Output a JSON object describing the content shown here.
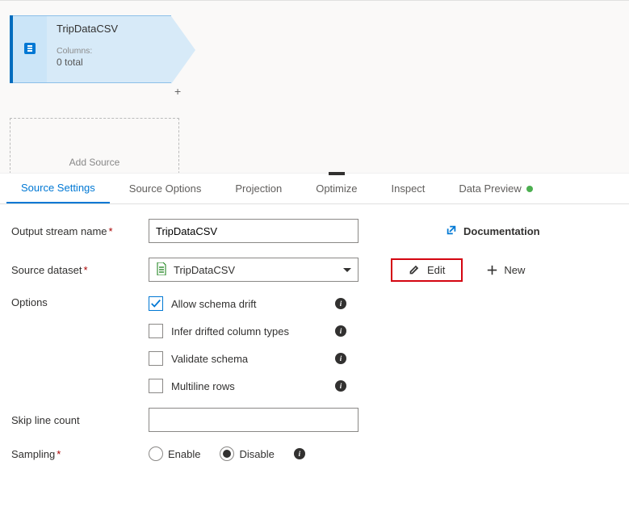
{
  "canvas": {
    "node_title": "TripDataCSV",
    "columns_label": "Columns:",
    "columns_count": "0 total",
    "add_source": "Add Source"
  },
  "tabs": {
    "source_settings": "Source Settings",
    "source_options": "Source Options",
    "projection": "Projection",
    "optimize": "Optimize",
    "inspect": "Inspect",
    "data_preview": "Data Preview"
  },
  "form": {
    "output_stream_label": "Output stream name",
    "output_stream_value": "TripDataCSV",
    "source_dataset_label": "Source dataset",
    "source_dataset_value": "TripDataCSV",
    "documentation": "Documentation",
    "edit": "Edit",
    "new": "New",
    "options_label": "Options",
    "opt_schema_drift": "Allow schema drift",
    "opt_infer": "Infer drifted column types",
    "opt_validate": "Validate schema",
    "opt_multiline": "Multiline rows",
    "skip_line_label": "Skip line count",
    "sampling_label": "Sampling",
    "enable": "Enable",
    "disable": "Disable"
  }
}
